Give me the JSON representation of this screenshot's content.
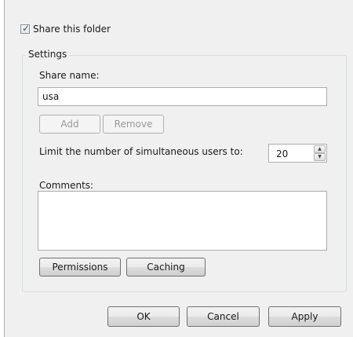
{
  "share_checkbox": {
    "label": "Share this folder",
    "checked": true
  },
  "settings": {
    "legend": "Settings",
    "share_name_label": "Share name:",
    "share_name_value": "usa",
    "add_label": "Add",
    "remove_label": "Remove",
    "limit_label": "Limit the number of simultaneous users to:",
    "limit_value": "20",
    "comments_label": "Comments:",
    "comments_value": "",
    "permissions_label": "Permissions",
    "caching_label": "Caching"
  },
  "footer": {
    "ok_label": "OK",
    "cancel_label": "Cancel",
    "apply_label": "Apply"
  },
  "icons": {
    "check": "check-icon",
    "spin_up": "spin-up-icon",
    "spin_down": "spin-down-icon"
  }
}
